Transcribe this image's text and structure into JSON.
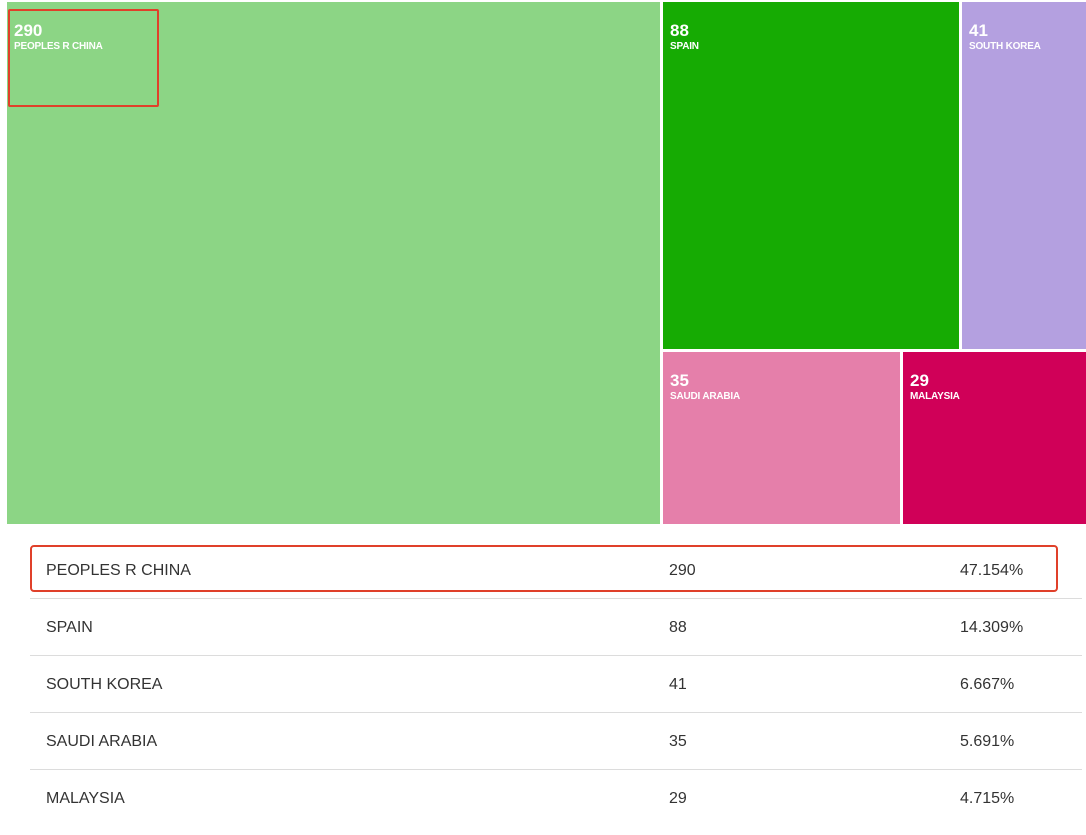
{
  "chart_data": {
    "type": "treemap",
    "items": [
      {
        "name": "PEOPLES R CHINA",
        "value": 290,
        "percent": "47.154%",
        "color": "#8cd585"
      },
      {
        "name": "SPAIN",
        "value": 88,
        "percent": "14.309%",
        "color": "#16ab03"
      },
      {
        "name": "SOUTH KOREA",
        "value": 41,
        "percent": "6.667%",
        "color": "#b4a0e0"
      },
      {
        "name": "SAUDI ARABIA",
        "value": 35,
        "percent": "5.691%",
        "color": "#e57faa"
      },
      {
        "name": "MALAYSIA",
        "value": 29,
        "percent": "4.715%",
        "color": "#d00058"
      }
    ],
    "highlighted": "PEOPLES R CHINA",
    "highlight_color": "#e0402a"
  },
  "table": {
    "rows": [
      {
        "country": "PEOPLES R CHINA",
        "count": "290",
        "percent": "47.154%"
      },
      {
        "country": "SPAIN",
        "count": "88",
        "percent": "14.309%"
      },
      {
        "country": "SOUTH KOREA",
        "count": "41",
        "percent": "6.667%"
      },
      {
        "country": "SAUDI ARABIA",
        "count": "35",
        "percent": "5.691%"
      },
      {
        "country": "MALAYSIA",
        "count": "29",
        "percent": "4.715%"
      }
    ]
  }
}
